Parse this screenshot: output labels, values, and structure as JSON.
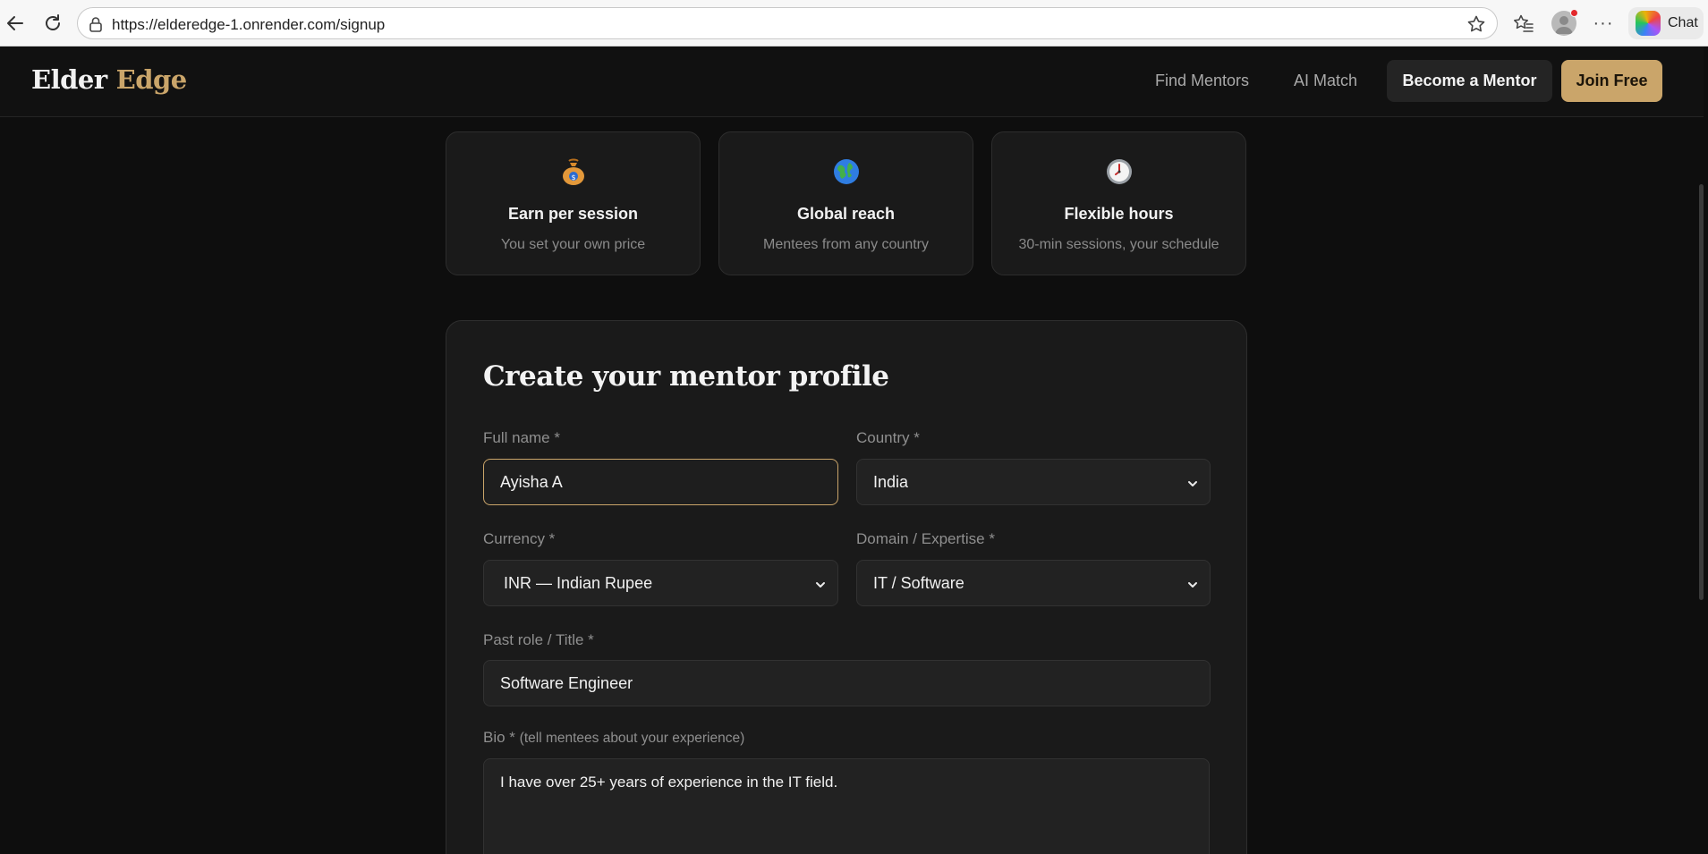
{
  "browser": {
    "url": "https://elderedge-1.onrender.com/signup",
    "chat_label": "Chat"
  },
  "header": {
    "logo_primary": "Elder",
    "logo_accent": "Edge",
    "nav": [
      "Find Mentors",
      "AI Match"
    ],
    "become_mentor": "Become a Mentor",
    "join_free": "Join Free"
  },
  "features": [
    {
      "icon": "money-bag-icon",
      "title": "Earn per session",
      "subtitle": "You set your own price"
    },
    {
      "icon": "globe-icon",
      "title": "Global reach",
      "subtitle": "Mentees from any country"
    },
    {
      "icon": "clock-icon",
      "title": "Flexible hours",
      "subtitle": "30-min sessions, your schedule"
    }
  ],
  "form": {
    "title": "Create your mentor profile",
    "full_name": {
      "label": "Full name *",
      "value": "Ayisha A"
    },
    "country": {
      "label": "Country *",
      "value": "India"
    },
    "currency": {
      "label": "Currency *",
      "value": "INR — Indian Rupee"
    },
    "domain": {
      "label": "Domain / Expertise *",
      "value": "IT / Software"
    },
    "role": {
      "label": "Past role / Title *",
      "value": "Software Engineer"
    },
    "bio": {
      "label": "Bio *",
      "hint": "(tell mentees about your experience)",
      "value": "I have over 25+ years of experience in the IT field."
    }
  },
  "colors": {
    "accent": "#caa56a",
    "background": "#0e0e0e",
    "card": "#1a1a1a",
    "field": "#222222"
  }
}
